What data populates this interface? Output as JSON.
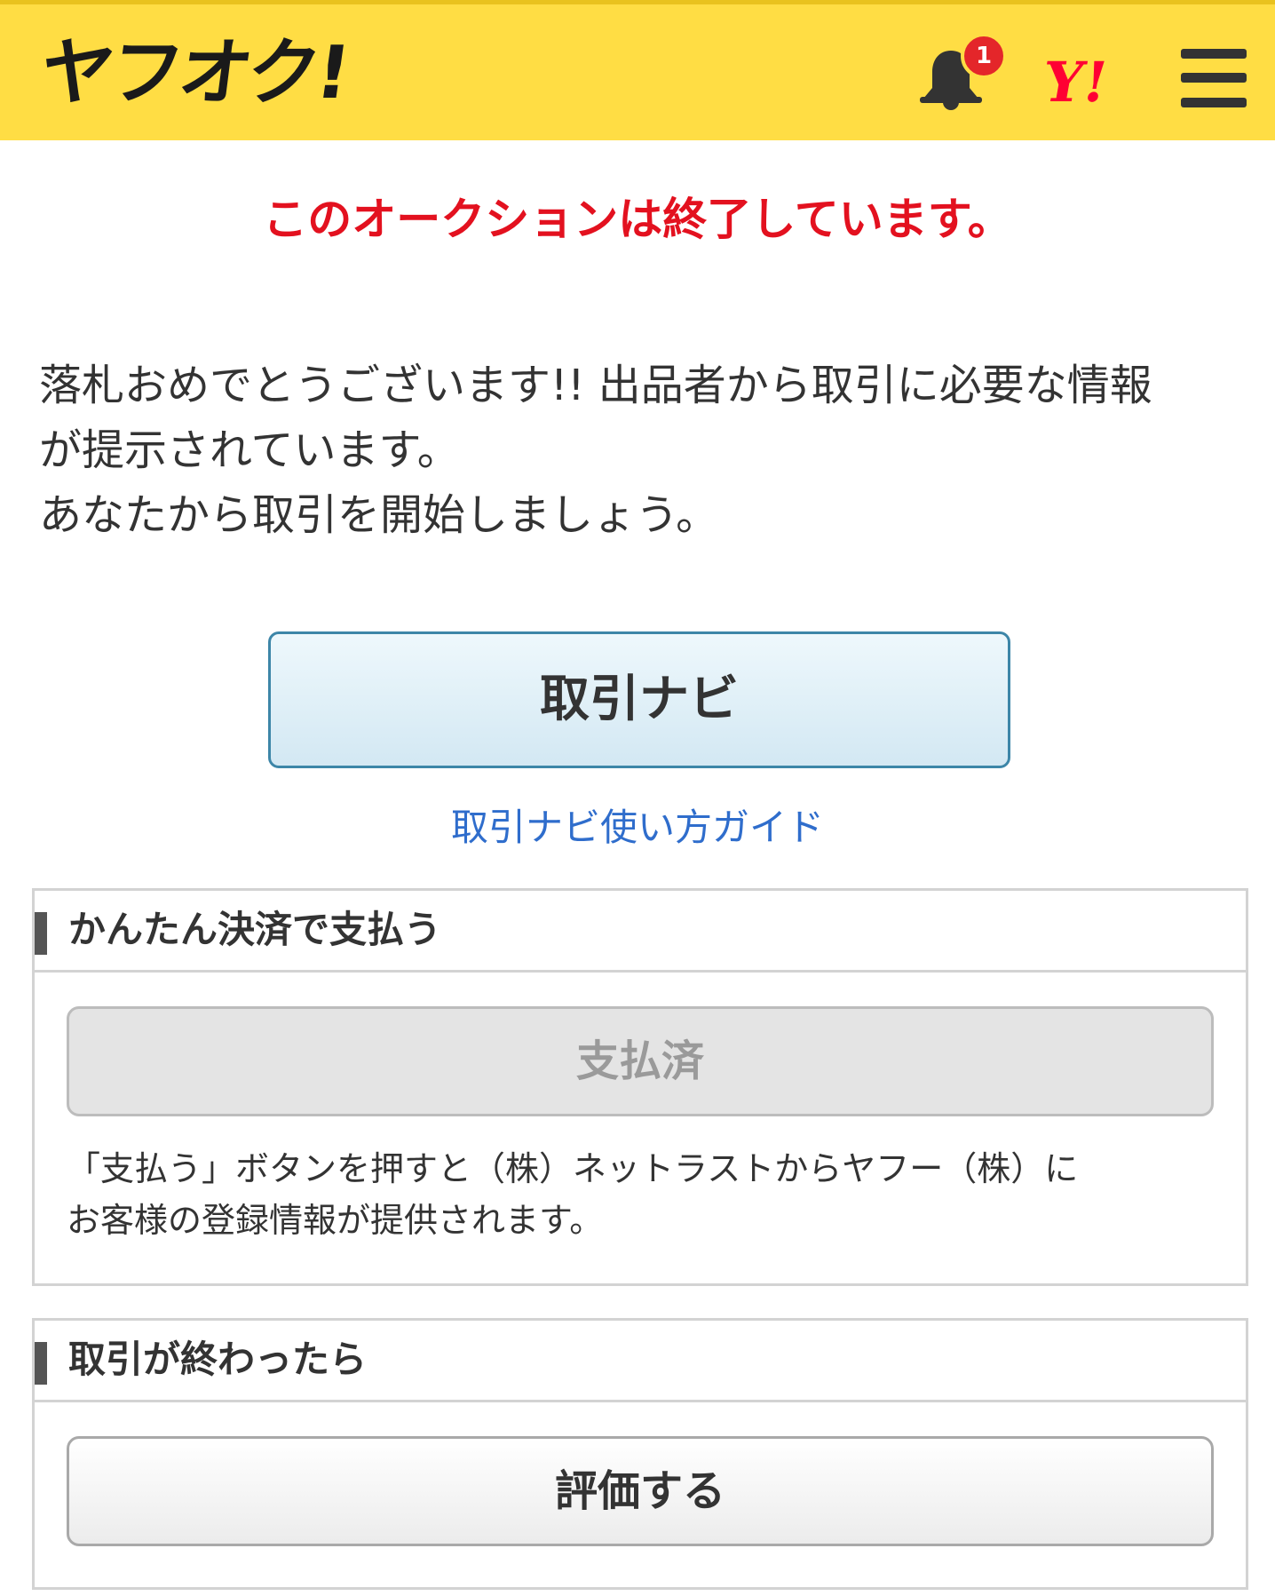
{
  "header": {
    "logo_text": "ヤフオク!",
    "notification_count": "1",
    "yahoo_logo_text": "Y!",
    "accent_color": "#ffdd44",
    "icons": [
      "bell-icon",
      "yahoo-logo",
      "hamburger-menu-icon"
    ]
  },
  "status": {
    "ended_message": "このオークションは終了しています。",
    "color": "#e3111f"
  },
  "message": {
    "line1": "落札おめでとうございます!! 出品者から取引に必要な情報",
    "line2": "が提示されています。",
    "line3": "あなたから取引を開始しましょう。"
  },
  "navi": {
    "button_label": "取引ナビ",
    "guide_link": "取引ナビ使い方ガイド"
  },
  "payment_section": {
    "title": "かんたん決済で支払う",
    "button_label": "支払済",
    "note_line1": "「支払う」ボタンを押すと（株）ネットラストからヤフー（株）に",
    "note_line2": "お客様の登録情報が提供されます。"
  },
  "completion_section": {
    "title": "取引が終わったら",
    "button_label": "評価する"
  }
}
